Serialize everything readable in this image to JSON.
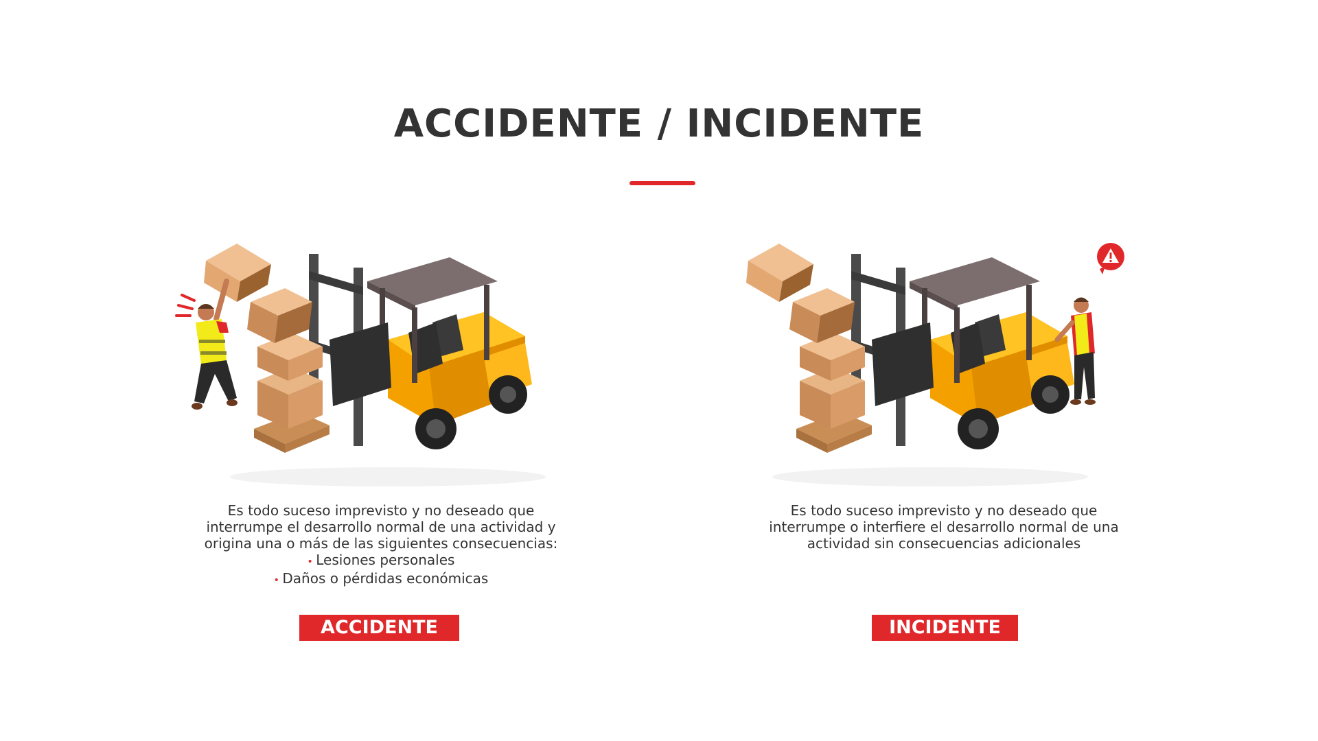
{
  "title": "ACCIDENTE / INCIDENTE",
  "accent_color": "#e0282b",
  "accidente": {
    "label": "ACCIDENTE",
    "description_lines": [
      "Es todo suceso imprevisto y no deseado que",
      "interrumpe el desarrollo normal de una actividad y",
      "origina una o más de las siguientes consecuencias:"
    ],
    "bullets": [
      "Lesiones personales",
      "Daños o pérdidas económicas"
    ],
    "illustration": "forklift-accident-illustration"
  },
  "incidente": {
    "label": "INCIDENTE",
    "description_lines": [
      "Es todo suceso imprevisto y no deseado que",
      "interrumpe o interfiere el desarrollo normal de una",
      "actividad sin consecuencias adicionales"
    ],
    "illustration": "forklift-incident-illustration",
    "warning_icon": "warning-icon"
  }
}
